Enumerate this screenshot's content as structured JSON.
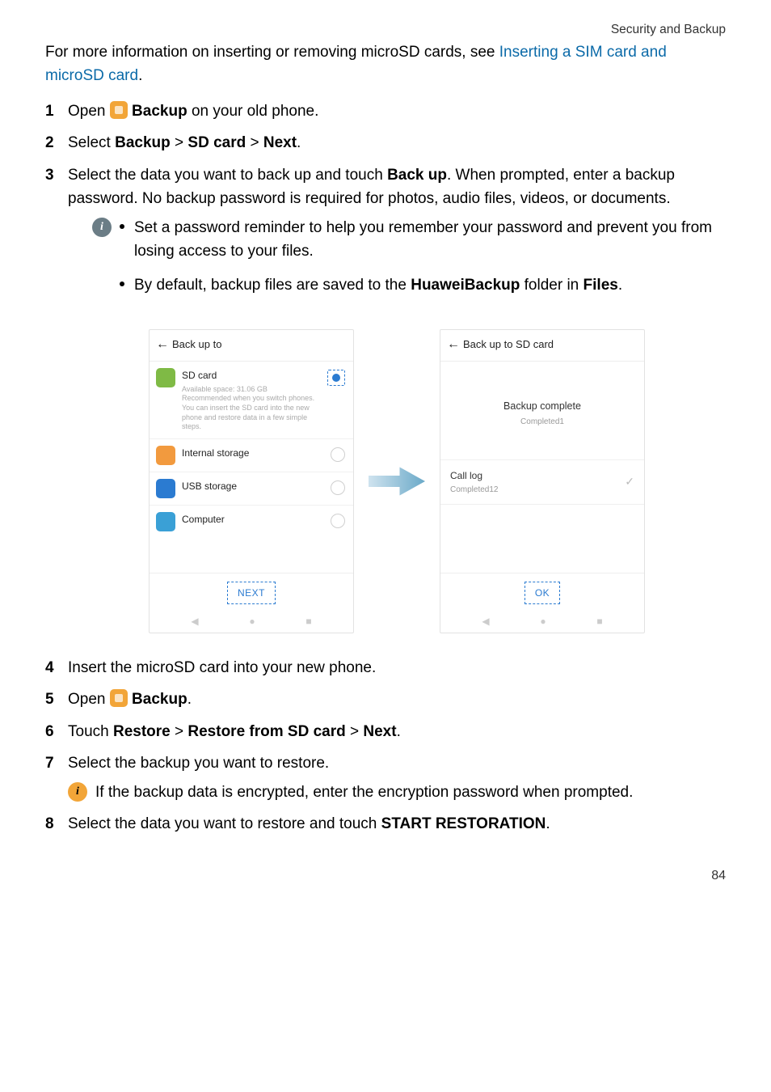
{
  "header": "Security and Backup",
  "intro_prefix": "For more information on inserting or removing microSD cards, see ",
  "intro_link": "Inserting a SIM card and microSD card",
  "intro_suffix": ".",
  "step1_open": "Open ",
  "step1_backup": "Backup",
  "step1_rest": " on your old phone.",
  "step2_select": "Select ",
  "step2_b1": "Backup",
  "step2_gt1": " > ",
  "step2_b2": "SD card",
  "step2_gt2": " > ",
  "step2_b3": "Next",
  "step2_end": ".",
  "step3_a": "Select the data you want to back up and touch ",
  "step3_bold": "Back up",
  "step3_b": ". When prompted, enter a backup password. No backup password is required for photos, audio files, videos, or documents.",
  "step3_bullet1": "Set a password reminder to help you remember your password and prevent you from losing access to your files.",
  "step3_bullet2a": "By default, backup files are saved to the ",
  "step3_bullet2b": "HuaweiBackup",
  "step3_bullet2c": " folder in ",
  "step3_bullet2d": "Files",
  "step3_bullet2e": ".",
  "step4": "Insert the microSD card into your new phone.",
  "step5_open": "Open ",
  "step5_backup": "Backup",
  "step5_end": ".",
  "step6_a": "Touch ",
  "step6_b1": "Restore",
  "step6_gt1": " > ",
  "step6_b2": "Restore from SD card",
  "step6_gt2": " > ",
  "step6_b3": "Next",
  "step6_end": ".",
  "step7": "Select the backup you want to restore.",
  "step7_note": "If the backup data is encrypted, enter the encryption password when prompted.",
  "step8_a": "Select the data you want to restore and touch ",
  "step8_b": "START RESTORATION",
  "step8_c": ".",
  "page_number": "84",
  "shot1": {
    "title": "Back up to",
    "sd_title": "SD card",
    "sd_sub": "Available space: 31.06 GB\nRecommended when you switch phones. You can insert the SD card into the new phone and restore data in a few simple steps.",
    "row2": "Internal storage",
    "row3": "USB storage",
    "row4": "Computer",
    "btn": "NEXT"
  },
  "shot2": {
    "title": "Back up to SD card",
    "msg1": "Backup complete",
    "msg2": "Completed1",
    "r_label": "Call log",
    "r_sub": "Completed12",
    "btn": "OK"
  }
}
